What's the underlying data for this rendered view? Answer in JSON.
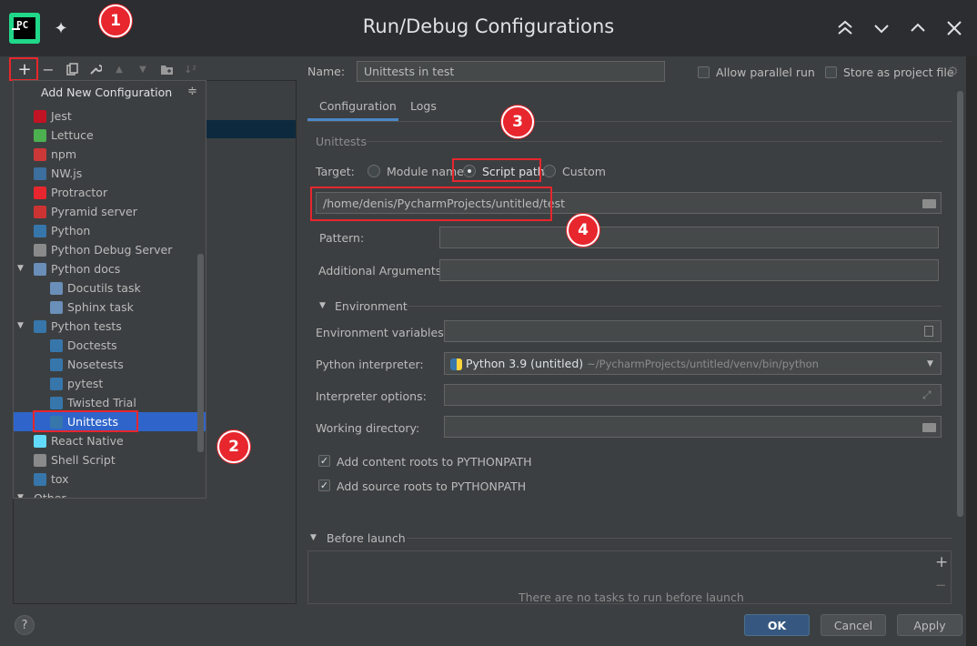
{
  "window": {
    "title": "Run/Debug Configurations",
    "app_icon_text": "PC"
  },
  "toolbar": {
    "add_label": "+",
    "remove_label": "−",
    "copy_label": "⧉",
    "edit_label": "🔧",
    "up_label": "▲",
    "down_label": "▼",
    "folder_label": "📁",
    "sort_label": "↓²"
  },
  "popup": {
    "header": "Add New Configuration",
    "collapse_icon": "≑",
    "items": [
      {
        "label": "Jest",
        "icon": "jest-icon",
        "color": "#c21325"
      },
      {
        "label": "Lettuce",
        "icon": "lettuce-icon",
        "color": "#4caf50"
      },
      {
        "label": "npm",
        "icon": "npm-icon",
        "color": "#cb3837"
      },
      {
        "label": "NW.js",
        "icon": "nwjs-icon",
        "color": "#3c6e9e"
      },
      {
        "label": "Protractor",
        "icon": "protractor-icon",
        "color": "#e8262d"
      },
      {
        "label": "Pyramid server",
        "icon": "pyramid-icon",
        "color": "#cc3333"
      },
      {
        "label": "Python",
        "icon": "python-icon",
        "color": "#3776ab"
      },
      {
        "label": "Python Debug Server",
        "icon": "debug-server-icon",
        "color": "#8a8a8a"
      },
      {
        "label": "Python docs",
        "icon": "python-docs-icon",
        "color": "#6a8fb8"
      },
      {
        "label": "Docutils task",
        "icon": "docutils-icon",
        "color": "#6a8fb8"
      },
      {
        "label": "Sphinx task",
        "icon": "sphinx-icon",
        "color": "#6a8fb8"
      },
      {
        "label": "Python tests",
        "icon": "python-tests-icon",
        "color": "#3776ab"
      },
      {
        "label": "Doctests",
        "icon": "doctests-icon",
        "color": "#3776ab"
      },
      {
        "label": "Nosetests",
        "icon": "nosetests-icon",
        "color": "#3776ab"
      },
      {
        "label": "pytest",
        "icon": "pytest-icon",
        "color": "#3776ab"
      },
      {
        "label": "Twisted Trial",
        "icon": "twisted-icon",
        "color": "#3776ab"
      },
      {
        "label": "Unittests",
        "icon": "unittests-icon",
        "color": "#3776ab"
      },
      {
        "label": "React Native",
        "icon": "react-icon",
        "color": "#61dafb"
      },
      {
        "label": "Shell Script",
        "icon": "shell-icon",
        "color": "#8a8a8a"
      },
      {
        "label": "tox",
        "icon": "tox-icon",
        "color": "#3776ab"
      },
      {
        "label": "Other",
        "icon": "",
        "color": "#bbbbbb"
      }
    ]
  },
  "annotations": {
    "b1": "1",
    "b2": "2",
    "b3": "3",
    "b4": "4",
    "color": "#e8262d"
  },
  "form": {
    "name_label": "Name:",
    "name_value": "Unittests in test",
    "allow_parallel": "Allow parallel run",
    "store_project": "Store as project file",
    "tabs": [
      "Configuration",
      "Logs"
    ],
    "section_title": "Unittests",
    "target_label": "Target:",
    "target_module": "Module name",
    "target_script": "Script path",
    "target_custom": "Custom",
    "script_path": "/home/denis/PycharmProjects/untitled/test",
    "pattern_label": "Pattern:",
    "additional_label": "Additional Arguments:",
    "environment_label": "Environment",
    "env_vars_label": "Environment variables:",
    "interpreter_label": "Python interpreter:",
    "interpreter_value": "Python 3.9 (untitled)",
    "interpreter_path": "~/PycharmProjects/untitled/venv/bin/python",
    "interp_options_label": "Interpreter options:",
    "workdir_label": "Working directory:",
    "content_roots": "Add content roots to PYTHONPATH",
    "source_roots": "Add source roots to PYTHONPATH",
    "before_launch": "Before launch",
    "no_tasks": "There are no tasks to run before launch"
  },
  "buttons": {
    "ok": "OK",
    "cancel": "Cancel",
    "apply": "Apply",
    "help": "?"
  }
}
